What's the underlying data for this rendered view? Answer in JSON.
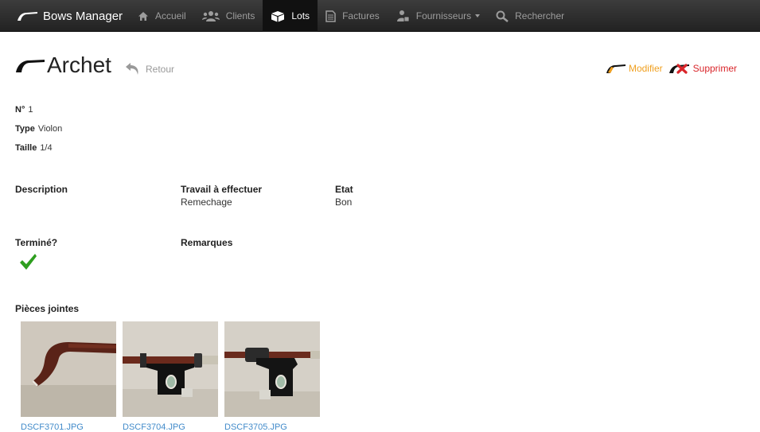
{
  "navbar": {
    "brand": "Bows Manager",
    "items": [
      {
        "label": "Accueil",
        "icon": "home-icon",
        "active": false
      },
      {
        "label": "Clients",
        "icon": "users-icon",
        "active": false
      },
      {
        "label": "Lots",
        "icon": "box-icon",
        "active": true
      },
      {
        "label": "Factures",
        "icon": "document-icon",
        "active": false
      },
      {
        "label": "Fournisseurs",
        "icon": "supplier-icon",
        "active": false,
        "dropdown": true
      },
      {
        "label": "Rechercher",
        "icon": "search-icon",
        "active": false
      }
    ]
  },
  "page": {
    "title": "Archet",
    "back_label": "Retour",
    "edit_label": "Modifier",
    "delete_label": "Supprimer"
  },
  "details": {
    "number_label": "N°",
    "number_value": "1",
    "type_label": "Type",
    "type_value": "Violon",
    "size_label": "Taille",
    "size_value": "1/4"
  },
  "info": {
    "description_label": "Description",
    "work_label": "Travail à effectuer",
    "work_value": "Remechage",
    "state_label": "Etat",
    "state_value": "Bon",
    "done_label": "Terminé?",
    "done": true,
    "remarks_label": "Remarques"
  },
  "attachments": {
    "label": "Pièces jointes",
    "files": [
      "DSCF3701.JPG",
      "DSCF3704.JPG",
      "DSCF3705.JPG"
    ]
  },
  "colors": {
    "edit": "#f0a020",
    "delete": "#d9252a",
    "check": "#2e9e1f",
    "link": "#428bca"
  }
}
